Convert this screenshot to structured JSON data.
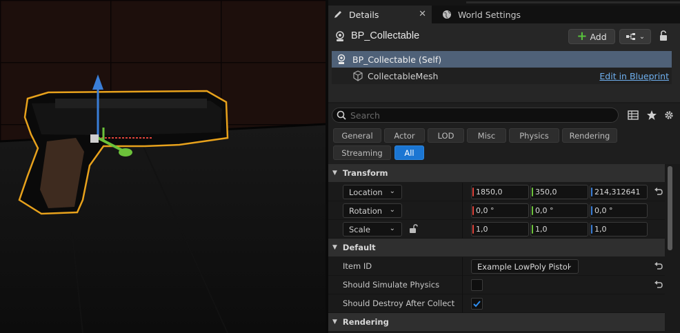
{
  "tabs": [
    {
      "label": "Details",
      "icon": "pencil-icon"
    },
    {
      "label": "World Settings",
      "icon": "globe-icon"
    }
  ],
  "actor": {
    "name": "BP_Collectable"
  },
  "toolbar": {
    "add_label": "Add"
  },
  "components": [
    {
      "label": "BP_Collectable (Self)"
    },
    {
      "label": "CollectableMesh"
    }
  ],
  "edit_link": "Edit in Blueprint",
  "search": {
    "placeholder": "Search",
    "value": ""
  },
  "filters": [
    "General",
    "Actor",
    "LOD",
    "Misc",
    "Physics",
    "Rendering",
    "Streaming",
    "All"
  ],
  "active_filter": "All",
  "sections": {
    "transform": "Transform",
    "default": "Default",
    "rendering": "Rendering"
  },
  "transform": {
    "location": {
      "label": "Location",
      "x": "1850,0",
      "y": "350,0",
      "z": "214,312641"
    },
    "rotation": {
      "label": "Rotation",
      "x": "0,0 °",
      "y": "0,0 °",
      "z": "0,0 °"
    },
    "scale": {
      "label": "Scale",
      "x": "1,0",
      "y": "1,0",
      "z": "1,0"
    }
  },
  "default": {
    "item_id": {
      "label": "Item ID",
      "value": "Example LowPoly Pistol"
    },
    "simulate_physics": {
      "label": "Should Simulate Physics",
      "checked": false
    },
    "destroy_after_collect": {
      "label": "Should Destroy After Collect",
      "checked": true
    }
  },
  "colors": {
    "x_axis": "#e0443b",
    "y_axis": "#6cc23a",
    "z_axis": "#3a7ed8",
    "selection_outline": "#e8a21c",
    "accent": "#1b76d3"
  }
}
